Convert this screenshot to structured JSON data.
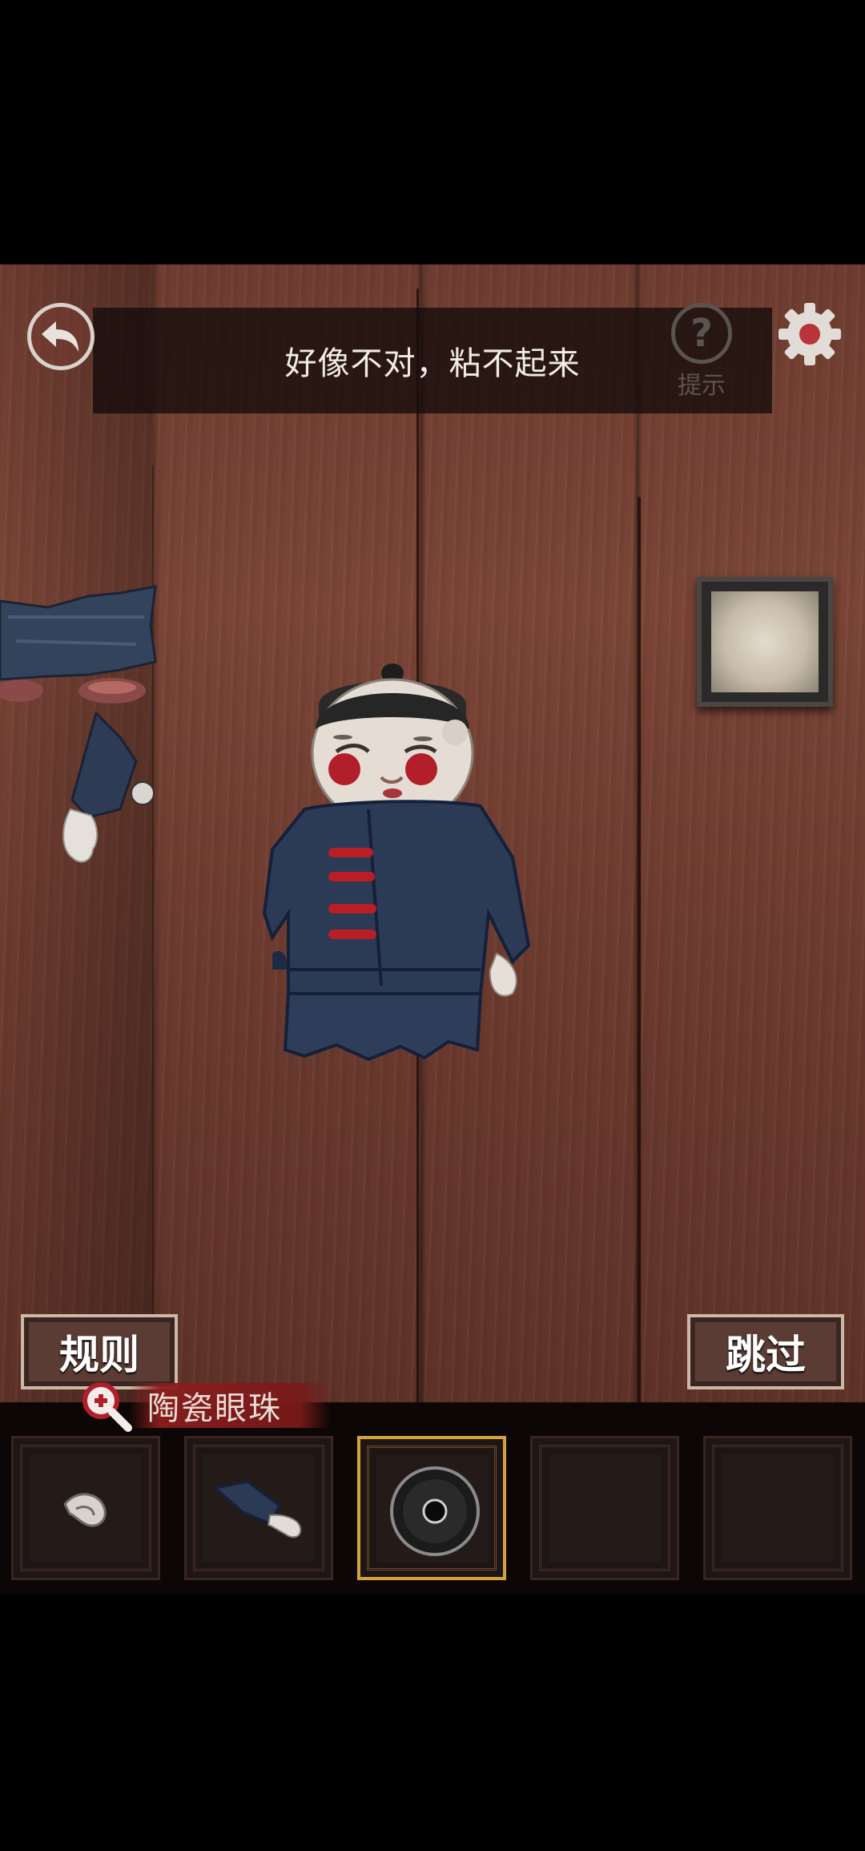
{
  "message": "好像不对，粘不起来",
  "hint": {
    "label": "提示",
    "glyph": "?"
  },
  "buttons": {
    "rules": "规则",
    "skip": "跳过"
  },
  "selected_item": {
    "name": "陶瓷眼珠"
  },
  "inventory": [
    {
      "slot": 1,
      "item": "ceramic-ear",
      "selected": false
    },
    {
      "slot": 2,
      "item": "ceramic-arm",
      "selected": false
    },
    {
      "slot": 3,
      "item": "ceramic-eyeball",
      "selected": true
    },
    {
      "slot": 4,
      "item": "",
      "selected": false
    },
    {
      "slot": 5,
      "item": "",
      "selected": false
    }
  ],
  "colors": {
    "accent_gold": "#d6a23a",
    "label_red": "#8c1e1e",
    "wood": "#6e3c30",
    "coat_blue": "#2c3a52",
    "button_red": "#b8343a"
  }
}
